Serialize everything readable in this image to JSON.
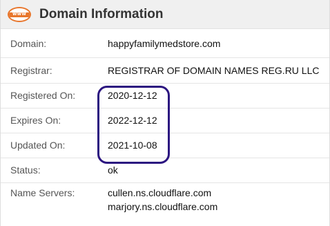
{
  "header": {
    "icon_text": "www",
    "title": "Domain Information"
  },
  "rows": [
    {
      "label": "Domain:",
      "value": "happyfamilymedstore.com"
    },
    {
      "label": "Registrar:",
      "value": "REGISTRAR OF DOMAIN NAMES REG.RU LLC"
    },
    {
      "label": "Registered On:",
      "value": "2020-12-12"
    },
    {
      "label": "Expires On:",
      "value": "2022-12-12"
    },
    {
      "label": "Updated On:",
      "value": "2021-10-08"
    },
    {
      "label": "Status:",
      "value": "ok"
    },
    {
      "label": "Name Servers:",
      "values": [
        "cullen.ns.cloudflare.com",
        "marjory.ns.cloudflare.com"
      ]
    }
  ],
  "colors": {
    "accent": "#e8762c",
    "highlight": "#2b1480"
  }
}
